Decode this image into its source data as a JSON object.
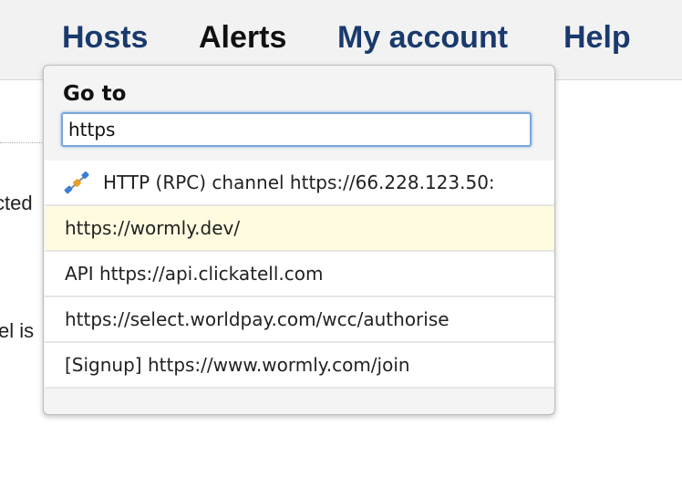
{
  "nav": {
    "items": [
      {
        "label": "Hosts"
      },
      {
        "label": "Alerts"
      },
      {
        "label": "My account"
      },
      {
        "label": "Help"
      }
    ]
  },
  "background": {
    "text_1": "cted",
    "text_2": "el is"
  },
  "dropdown": {
    "title": "Go to",
    "search_value": "https",
    "results": [
      {
        "label": "HTTP (RPC) channel https://66.228.123.50:",
        "icon": "plug-connector-icon"
      },
      {
        "label": "https://wormly.dev/",
        "highlighted": true
      },
      {
        "label": "API https://api.clickatell.com"
      },
      {
        "label": "https://select.worldpay.com/wcc/authorise"
      },
      {
        "label": "[Signup] https://www.wormly.com/join"
      }
    ]
  },
  "colors": {
    "nav_link": "#1a3a6e",
    "nav_active": "#111111",
    "highlight_row": "#fefbe0",
    "input_focus": "#7aa7d9"
  }
}
